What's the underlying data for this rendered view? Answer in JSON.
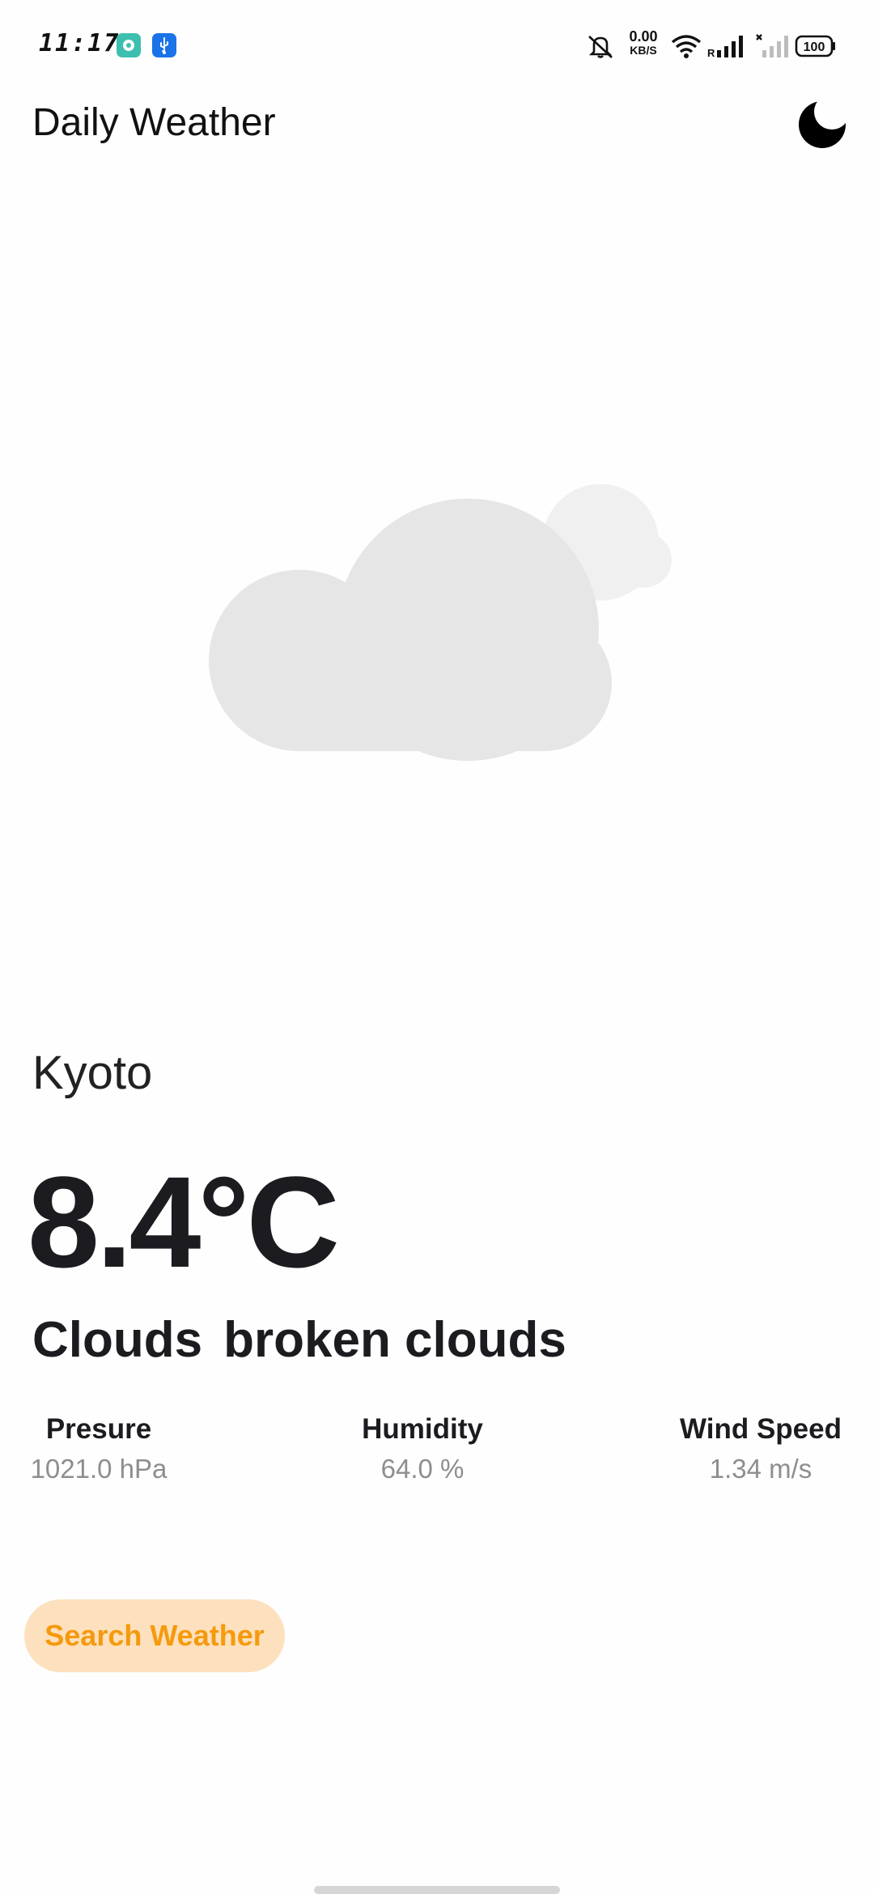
{
  "status_bar": {
    "time": "11:17",
    "net_speed_value": "0.00",
    "net_speed_unit": "KB/S",
    "roaming_label": "R",
    "battery_level": "100",
    "icons": [
      "chat-notification-icon",
      "usb-icon",
      "mute-icon",
      "wifi-icon",
      "signal-icon",
      "signal-no-service-icon",
      "battery-icon"
    ]
  },
  "app_bar": {
    "title": "Daily Weather",
    "theme_toggle_icon": "moon-icon"
  },
  "weather": {
    "icon": "cloudy-icon",
    "city": "Kyoto",
    "temperature": "8.4°C",
    "main_condition": "Clouds",
    "description": "broken clouds",
    "stats": {
      "pressure": {
        "label": "Presure",
        "value": "1021.0 hPa"
      },
      "humidity": {
        "label": "Humidity",
        "value": "64.0 %"
      },
      "wind": {
        "label": "Wind Speed",
        "value": "1.34 m/s"
      }
    }
  },
  "actions": {
    "search_label": "Search Weather"
  },
  "colors": {
    "accent": "#f59a0c",
    "button_bg": "#fde0bd",
    "cloud_front": "#e6e6e6",
    "cloud_back": "#f0f0f0",
    "muted_text": "#8e8e8e"
  }
}
